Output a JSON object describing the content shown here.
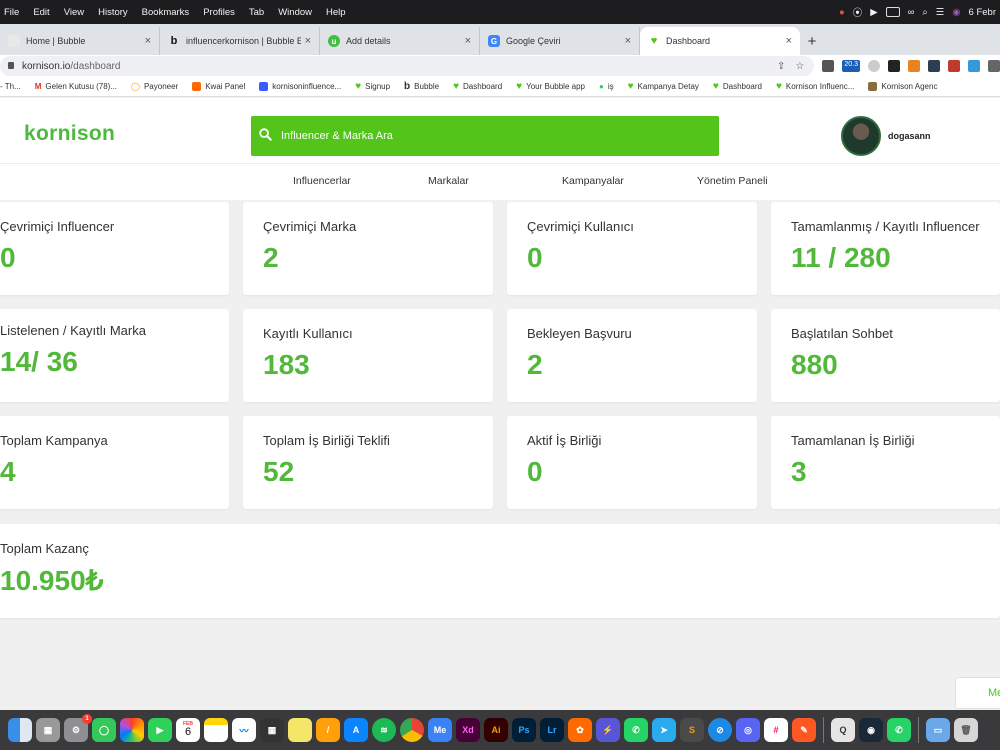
{
  "menubar": {
    "items": [
      "File",
      "Edit",
      "View",
      "History",
      "Bookmarks",
      "Profiles",
      "Tab",
      "Window",
      "Help"
    ],
    "date": "6 Febr"
  },
  "tabs": [
    {
      "label": "Home | Bubble",
      "icon": "bubble-favicon"
    },
    {
      "label": "influencerkornison | Bubble Ed",
      "icon": "bubble-b-favicon"
    },
    {
      "label": "Add details",
      "icon": "upwork-favicon"
    },
    {
      "label": "Google Çeviri",
      "icon": "google-translate-favicon"
    },
    {
      "label": "Dashboard",
      "icon": "green-heart-favicon",
      "active": true
    }
  ],
  "omnibox": {
    "domain": "kornison.io",
    "path": "/dashboard",
    "ext_badge": "20.3"
  },
  "bookmarks": [
    {
      "label": "- Th...",
      "icon": "none"
    },
    {
      "label": "Gelen Kutusu (78)...",
      "icon": "gmail"
    },
    {
      "label": "Payoneer",
      "icon": "payoneer"
    },
    {
      "label": "Kwai Panel",
      "icon": "kwai"
    },
    {
      "label": "kornisoninfluence...",
      "icon": "blue-square"
    },
    {
      "label": "Signup",
      "icon": "green-heart"
    },
    {
      "label": "Bubble",
      "icon": "bubble-b"
    },
    {
      "label": "Dashboard",
      "icon": "green-heart"
    },
    {
      "label": "Your Bubble app",
      "icon": "green-heart"
    },
    {
      "label": "iş",
      "icon": "whatsapp"
    },
    {
      "label": "Kampanya Detay",
      "icon": "green-heart"
    },
    {
      "label": "Dashboard",
      "icon": "green-heart"
    },
    {
      "label": "Kornison Influenc...",
      "icon": "green-heart"
    },
    {
      "label": "Kornison Agenc",
      "icon": "kornison"
    }
  ],
  "header": {
    "logo": "kornison",
    "search_placeholder": "Influencer & Marka Ara",
    "username": "dogasann"
  },
  "nav": [
    "Influencerlar",
    "Markalar",
    "Kampanyalar",
    "Yönetim Paneli"
  ],
  "stats": [
    {
      "title": "Çevrimiçi Influencer",
      "value": "0"
    },
    {
      "title": "Çevrimiçi Marka",
      "value": "2"
    },
    {
      "title": "Çevrimiçi Kullanıcı",
      "value": "0"
    },
    {
      "title": "Tamamlanmış / Kayıtlı Influencer",
      "value": "11 / 280"
    },
    {
      "title": "Listelenen / Kayıtlı Marka",
      "value": "14/ 36"
    },
    {
      "title": "Kayıtlı Kullanıcı",
      "value": "183"
    },
    {
      "title": "Bekleyen Başvuru",
      "value": "2"
    },
    {
      "title": "Başlatılan Sohbet",
      "value": "880"
    },
    {
      "title": "Toplam Kampanya",
      "value": "4"
    },
    {
      "title": "Toplam İş Birliği Teklifi",
      "value": "52"
    },
    {
      "title": "Aktif İş Birliği",
      "value": "0"
    },
    {
      "title": "Tamamlanan İş Birliği",
      "value": "3"
    }
  ],
  "total": {
    "title": "Toplam Kazanç",
    "value": "10.950₺"
  },
  "float_button": "Me",
  "dock": {
    "calendar_month": "FEB",
    "calendar_day": "6",
    "badge": "1",
    "apps": [
      "finder",
      "launchpad",
      "system-preferences",
      "messages",
      "photos",
      "facetime",
      "calendar",
      "notes",
      "freeform",
      "calculator",
      "stickies",
      "pages",
      "app-store",
      "spotify",
      "chrome",
      "medium",
      "adobe-xd",
      "illustrator",
      "photoshop",
      "lightroom",
      "kwai",
      "shortcuts",
      "whatsapp",
      "telegram",
      "sublime",
      "safari",
      "discord",
      "slack",
      "pen-app",
      "quicktime",
      "steam",
      "whatsapp-2",
      "downloads",
      "trash"
    ]
  },
  "colors": {
    "accent": "#52c41a",
    "value_green": "#52b83a"
  }
}
